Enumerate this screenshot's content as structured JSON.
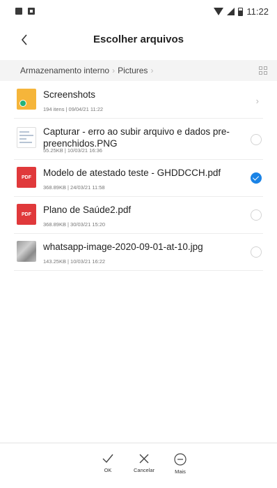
{
  "status_bar": {
    "time": "11:22"
  },
  "header": {
    "title": "Escolher arquivos"
  },
  "breadcrumb": {
    "items": [
      "Armazenamento interno",
      "Pictures"
    ]
  },
  "files": [
    {
      "name": "Screenshots",
      "meta": "194 itens | 09/04/21 11:22",
      "type": "folder",
      "selected": false
    },
    {
      "name": "Capturar - erro ao subir arquivo e dados pre-preenchidos.PNG",
      "meta": "55.25KB | 10/03/21 16:36",
      "type": "image-doc",
      "selected": false
    },
    {
      "name": "Modelo de atestado teste - GHDDCCH.pdf",
      "meta": "368.89KB | 24/03/21 11:58",
      "type": "pdf",
      "selected": true
    },
    {
      "name": "Plano de Saúde2.pdf",
      "meta": "368.89KB | 30/03/21 15:20",
      "type": "pdf",
      "selected": false
    },
    {
      "name": "whatsapp-image-2020-09-01-at-10.jpg",
      "meta": "143.25KB | 10/03/21 16:22",
      "type": "photo",
      "selected": false
    }
  ],
  "pdf_label": "PDF",
  "actions": {
    "ok": "OK",
    "cancel": "Cancelar",
    "more": "Mais"
  },
  "colors": {
    "accent": "#1a83e6",
    "pdf": "#e0393b",
    "folder": "#f5b53a"
  }
}
